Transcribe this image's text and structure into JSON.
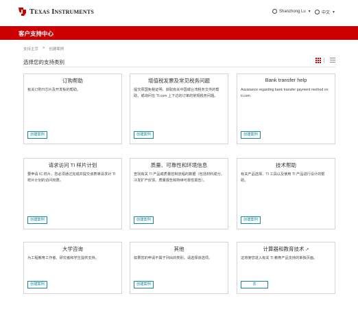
{
  "header": {
    "brand": {
      "prefix": "T",
      "first": "EXAS",
      "second_prefix": "I",
      "second": "NSTRUMENTS"
    },
    "user_name": "Shanzhong Lu",
    "language": "中文"
  },
  "banner": {
    "title": "客户支持中心"
  },
  "breadcrumb": {
    "home": "支持主页",
    "separator": ">",
    "current": "创建案例"
  },
  "page": {
    "title": "选择您的支持类别"
  },
  "colors": {
    "brand_red": "#cc0000",
    "button_teal": "#118899"
  },
  "cards": [
    {
      "title": "订购帮助",
      "desc": "有关订购TI芯片及开发板的帮助。",
      "button": "创建案例"
    },
    {
      "title": "增值税发票及常见税务问题",
      "desc": "提交原国免税证明、获取有关中国或台湾税务文件的帮助、或询问在 TI.com 上下达的订单的常规税务问题。",
      "button": "创建案例"
    },
    {
      "title": "Bank transfer help",
      "desc": "Assistance regarding bank transfer payment method on ti.com.",
      "button": "创建案例"
    },
    {
      "title": "请求访问 TI 样片计划",
      "desc": "要申请 IC 样片，您必须通过完成并提交该表单请求对 TI 样片计划的访问权限。",
      "button": "创建案例"
    },
    {
      "title": "质量、可靠性和环境信息",
      "desc": "查找有关 TI 产品或质量控制流程的数据（包括材料成分、冷发扩产反馈、质量报告和持续可靠性报告）。",
      "button": "创建案例"
    },
    {
      "title": "技术帮助",
      "desc": "有关产品选择、TI 工具以及使用 TI 产品进行设计的帮助。",
      "button": "创建案例"
    },
    {
      "title": "大学咨询",
      "desc": "为工程教育工作者、研究者和学生提供支持。",
      "button": "创建案例"
    },
    {
      "title": "其他",
      "desc": "如果您的申请不属于列出的类别，请选择该选项。",
      "button": "创建案例"
    },
    {
      "title": "计算器和教育技术",
      "desc": "这将使您进入有关 TI 教育产品支持的单独页面。",
      "button": "去"
    }
  ]
}
